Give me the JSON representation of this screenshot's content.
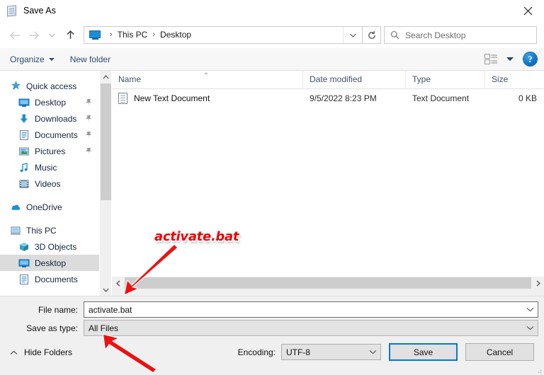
{
  "window": {
    "title": "Save As",
    "title_icon": "notepad-document-icon",
    "close_label": "✕"
  },
  "navbar": {
    "back_icon": "arrow-left-icon",
    "forward_icon": "arrow-right-icon",
    "recent_icon": "chevron-down-icon",
    "up_icon": "arrow-up-icon",
    "address_icon": "monitor-icon",
    "breadcrumb": [
      "This PC",
      "Desktop"
    ],
    "separator": "›",
    "dropdown_icon": "chevron-down-icon",
    "refresh_icon": "refresh-icon",
    "search": {
      "placeholder": "Search Desktop",
      "icon": "search-icon",
      "value": ""
    }
  },
  "toolbar": {
    "organize_label": "Organize",
    "new_folder_label": "New folder",
    "view_icon": "list-view-icon",
    "view_caret_icon": "chevron-down-icon",
    "help_icon": "help-question-icon",
    "help_label": "?"
  },
  "sidebar": {
    "scroll": {
      "up_icon": "chevron-up-icon",
      "down_icon": "chevron-down-icon"
    },
    "items": [
      {
        "label": "Quick access",
        "icon": "quick-access-star-icon",
        "indent": 0,
        "pinned": false,
        "selected": false
      },
      {
        "label": "Desktop",
        "icon": "desktop-monitor-icon",
        "indent": 1,
        "pinned": true,
        "selected": false
      },
      {
        "label": "Downloads",
        "icon": "downloads-arrow-icon",
        "indent": 1,
        "pinned": true,
        "selected": false
      },
      {
        "label": "Documents",
        "icon": "documents-file-icon",
        "indent": 1,
        "pinned": true,
        "selected": false
      },
      {
        "label": "Pictures",
        "icon": "pictures-image-icon",
        "indent": 1,
        "pinned": true,
        "selected": false
      },
      {
        "label": "Music",
        "icon": "music-note-icon",
        "indent": 1,
        "pinned": false,
        "selected": false
      },
      {
        "label": "Videos",
        "icon": "videos-film-icon",
        "indent": 1,
        "pinned": false,
        "selected": false
      },
      {
        "label": "OneDrive",
        "icon": "onedrive-cloud-icon",
        "indent": 0,
        "pinned": false,
        "selected": false
      },
      {
        "label": "This PC",
        "icon": "this-pc-computer-icon",
        "indent": 0,
        "pinned": false,
        "selected": false
      },
      {
        "label": "3D Objects",
        "icon": "3d-objects-cube-icon",
        "indent": 1,
        "pinned": false,
        "selected": false
      },
      {
        "label": "Desktop",
        "icon": "desktop-monitor-icon",
        "indent": 1,
        "pinned": false,
        "selected": true
      },
      {
        "label": "Documents",
        "icon": "documents-file-icon",
        "indent": 1,
        "pinned": false,
        "selected": false
      }
    ]
  },
  "file_list": {
    "columns": [
      "Name",
      "Date modified",
      "Type",
      "Size"
    ],
    "sort_indicator": "⌃",
    "rows": [
      {
        "name": "New Text Document",
        "icon": "text-document-icon",
        "date_modified": "9/5/2022 8:23 PM",
        "type": "Text Document",
        "size": "0 KB"
      }
    ],
    "hscroll": {
      "left_icon": "chevron-left-icon",
      "right_icon": "chevron-right-icon"
    }
  },
  "form": {
    "file_name_label": "File name:",
    "file_name_value": "activate.bat",
    "file_name_arrow": "chevron-down-icon",
    "save_as_type_label": "Save as type:",
    "save_as_type_value": "All Files",
    "save_as_type_arrow": "chevron-down-icon",
    "hide_folders_label": "Hide Folders",
    "hide_folders_icon": "chevron-up-icon",
    "encoding_label": "Encoding:",
    "encoding_value": "UTF-8",
    "encoding_arrow": "chevron-down-icon",
    "save_label": "Save",
    "cancel_label": "Cancel"
  },
  "annotations": {
    "callout_text": "activate.bat",
    "callout_color": "#ee0000",
    "arrow_color": "#ee1111",
    "arrow_count": 2
  }
}
